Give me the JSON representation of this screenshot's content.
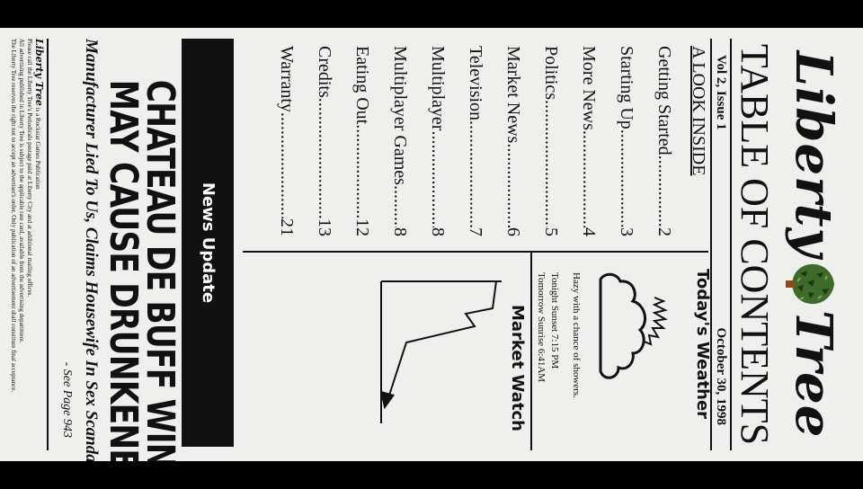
{
  "masthead": {
    "title_left": "Liberty",
    "title_right": "Tree",
    "logo": "tree-icon"
  },
  "header": {
    "title": "TABLE OF CONTENTS",
    "issue": "Vol 2, Issue 1",
    "date": "October 30, 1998"
  },
  "toc": {
    "heading": "A LOOK INSIDE",
    "items": [
      {
        "label": "Getting Started",
        "page": "2"
      },
      {
        "label": "Starting Up",
        "page": "3"
      },
      {
        "label": "More News",
        "page": "4"
      },
      {
        "label": "Politics",
        "page": "5"
      },
      {
        "label": "Market News",
        "page": "6"
      },
      {
        "label": "Television",
        "page": "7"
      },
      {
        "label": "Multiplayer",
        "page": "8"
      },
      {
        "label": "Multiplayer Games",
        "page": "8"
      },
      {
        "label": "Eating Out",
        "page": "12"
      },
      {
        "label": "Credits",
        "page": "13"
      },
      {
        "label": "Warranty",
        "page": "21"
      }
    ]
  },
  "weather": {
    "heading": "Today's Weather",
    "icon": "partly-cloudy-icon",
    "forecast": "Hazy with a chance of showers.",
    "sunset": "Tonight Sunset 7:15 PM",
    "sunrise": "Tomorrow Sunrise 6:41AM"
  },
  "market": {
    "heading": "Market Watch",
    "icon": "falling-arrow-chart-icon"
  },
  "news": {
    "label": "News Update",
    "headline_line1": "CHATEAU DE BUFF WINE",
    "headline_line2": "MAY CAUSE DRUNKENESS",
    "subhead": "Manufacturer Lied To Us, Claims Housewife In Sex Scandal",
    "see_page": "- See Page 943"
  },
  "footer": {
    "brand": "Liberty Tree",
    "line1": "is a Rockstar Games Publication",
    "line2": "Please call the Liberty Tree's Periodicals postage paid at Liberty City and at additional mailing offices.",
    "line3": "All advertising published in Liberty Tree is subject to the applicable rate card, available from the advertising department.",
    "line4": "The Liberty Tree reserves the right not to accept an advertiser's order. Only publication of an advertisement shall constitute final acceptance."
  },
  "colors": {
    "paper": "#efefed",
    "ink": "#111111",
    "tree_green": "#3f6b2a",
    "trunk": "#8a4a1c"
  }
}
